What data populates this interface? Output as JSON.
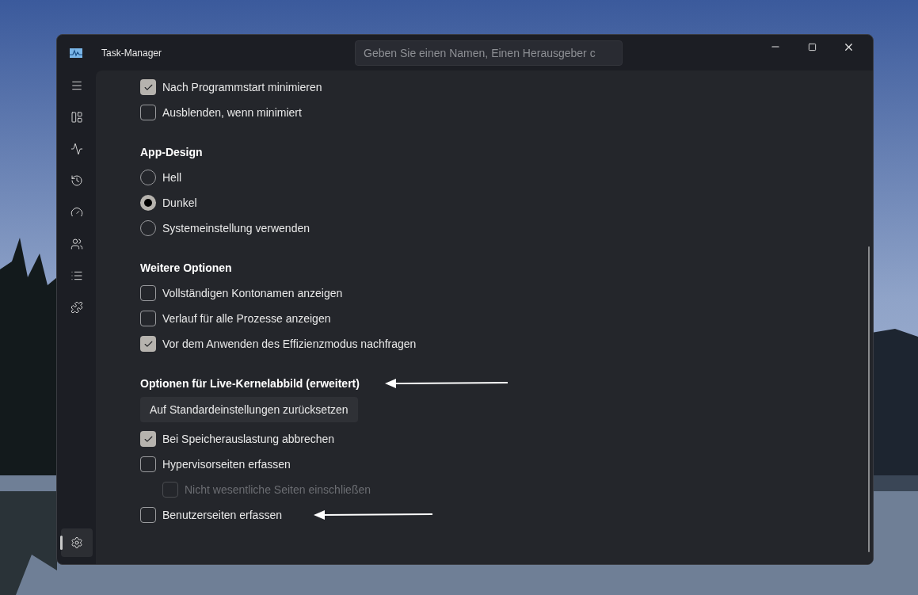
{
  "window": {
    "title": "Task-Manager"
  },
  "search": {
    "placeholder": "Geben Sie einen Namen, Einen Herausgeber c"
  },
  "nav": [
    {
      "kind": "menu",
      "selected": false
    },
    {
      "kind": "processes",
      "selected": false
    },
    {
      "kind": "performance",
      "selected": false
    },
    {
      "kind": "history",
      "selected": false
    },
    {
      "kind": "startup",
      "selected": false
    },
    {
      "kind": "users",
      "selected": false
    },
    {
      "kind": "details",
      "selected": false
    },
    {
      "kind": "services",
      "selected": false
    },
    {
      "kind": "settings",
      "selected": true
    }
  ],
  "settings": [
    {
      "items": [
        {
          "kind": "checkbox",
          "label": "Nach Programmstart minimieren",
          "checked": true,
          "disabled": false
        },
        {
          "kind": "checkbox",
          "label": "Ausblenden, wenn minimiert",
          "checked": false,
          "disabled": false
        }
      ]
    },
    {
      "heading": "App-Design",
      "items": [
        {
          "kind": "radio",
          "label": "Hell",
          "selected": false
        },
        {
          "kind": "radio",
          "label": "Dunkel",
          "selected": true
        },
        {
          "kind": "radio",
          "label": "Systemeinstellung verwenden",
          "selected": false
        }
      ]
    },
    {
      "heading": "Weitere Optionen",
      "items": [
        {
          "kind": "checkbox",
          "label": "Vollständigen Kontonamen anzeigen",
          "checked": false,
          "disabled": false
        },
        {
          "kind": "checkbox",
          "label": "Verlauf für alle Prozesse anzeigen",
          "checked": false,
          "disabled": false
        },
        {
          "kind": "checkbox",
          "label": "Vor dem Anwenden des Effizienzmodus nachfragen",
          "checked": true,
          "disabled": false
        }
      ]
    },
    {
      "heading": "Optionen für Live-Kernelabbild (erweitert)",
      "annotated": true,
      "items": [
        {
          "kind": "button",
          "label": "Auf Standardeinstellungen zurücksetzen"
        },
        {
          "kind": "checkbox",
          "label": "Bei Speicherauslastung abbrechen",
          "checked": true,
          "disabled": false
        },
        {
          "kind": "checkbox",
          "label": "Hypervisorseiten erfassen",
          "checked": false,
          "disabled": false,
          "children": [
            {
              "kind": "checkbox",
              "label": "Nicht wesentliche Seiten einschließen",
              "checked": false,
              "disabled": true
            }
          ]
        },
        {
          "kind": "checkbox",
          "label": "Benutzerseiten erfassen",
          "checked": false,
          "disabled": false,
          "annotated": true
        }
      ]
    }
  ]
}
